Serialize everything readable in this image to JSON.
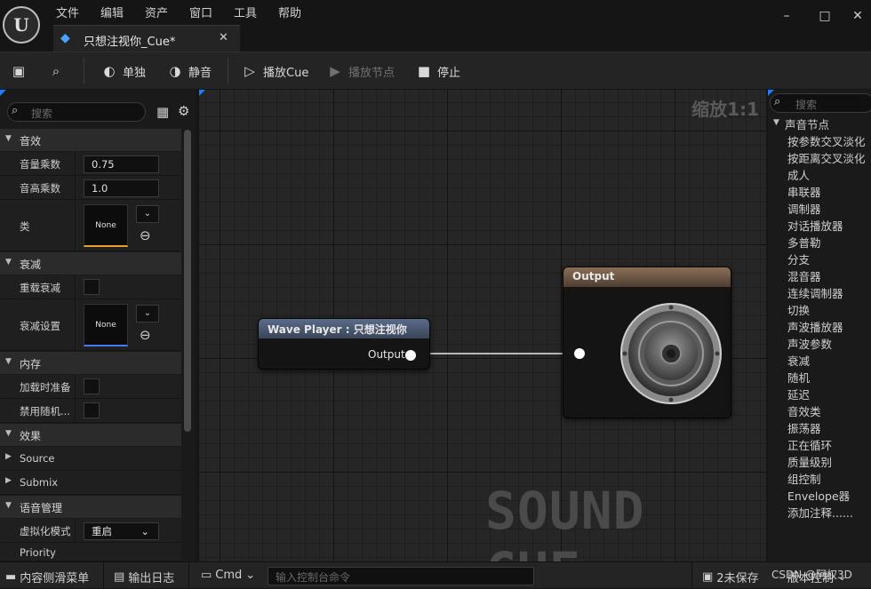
{
  "menu": [
    "文件",
    "编辑",
    "资产",
    "窗口",
    "工具",
    "帮助"
  ],
  "window_controls": {
    "minimize": "–",
    "maximize": "□",
    "close": "✕"
  },
  "tab": {
    "label": "只想注视你_Cue*",
    "close": "✕"
  },
  "toolbar": {
    "solo": "单独",
    "mute": "静音",
    "play_cue": "播放Cue",
    "play_node": "播放节点",
    "stop": "停止"
  },
  "details": {
    "search_placeholder": "搜索",
    "sections": {
      "sound": "音效",
      "attenuation": "衰减",
      "memory": "内存",
      "effects": "效果",
      "voice": "语音管理"
    },
    "props": {
      "volume_label": "音量乘数",
      "volume_value": "0.75",
      "pitch_label": "音高乘数",
      "pitch_value": "1.0",
      "class_label": "类",
      "class_value": "None",
      "override_atten_label": "重载衰减",
      "atten_settings_label": "衰减设置",
      "atten_settings_value": "None",
      "prime_label": "加载时准备",
      "disable_random_label": "禁用随机...",
      "source_label": "Source",
      "submix_label": "Submix",
      "virtualization_label": "虚拟化模式",
      "virtualization_value": "重启",
      "priority_label": "Priority"
    }
  },
  "graph": {
    "zoom": "缩放1:1",
    "watermark": "SOUND CUE",
    "wave_player": {
      "title": "Wave Player : 只想注视你",
      "output_pin": "Output"
    },
    "output_node": {
      "title": "Output"
    }
  },
  "palette": {
    "search_placeholder": "搜索",
    "category": "声音节点",
    "items": [
      "按参数交叉淡化",
      "按距离交叉淡化",
      "成人",
      "串联器",
      "调制器",
      "对话播放器",
      "多普勒",
      "分支",
      "混音器",
      "连续调制器",
      "切换",
      "声波播放器",
      "声波参数",
      "衰减",
      "随机",
      "延迟",
      "音效类",
      "振荡器",
      "正在循环",
      "质量级别",
      "组控制",
      "Envelope器",
      "添加注释......"
    ]
  },
  "statusbar": {
    "content_drawer": "内容侧滑菜单",
    "output_log": "输出日志",
    "cmd": "Cmd",
    "console_placeholder": "输入控制台命令",
    "unsaved": "2未保存",
    "source_control": "版本控制",
    "watermark_text": "CSDN @阿权3D"
  }
}
